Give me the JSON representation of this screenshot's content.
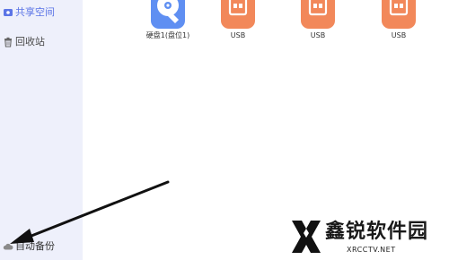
{
  "sidebar": {
    "items": [
      {
        "label": "共享空间",
        "icon": "share-space-icon",
        "active": true
      },
      {
        "label": "回收站",
        "icon": "recycle-bin-icon",
        "active": false
      },
      {
        "label": "自动备份",
        "icon": "cloud-backup-icon",
        "active": false
      }
    ]
  },
  "devices": [
    {
      "name": "硬盘1(盘位1)",
      "icon": "hard-disk-icon",
      "color": "#5f8ff2"
    },
    {
      "name": "USB",
      "icon": "usb-drive-icon",
      "color": "#f2885a"
    },
    {
      "name": "USB",
      "icon": "usb-drive-icon",
      "color": "#f2885a"
    },
    {
      "name": "USB",
      "icon": "usb-drive-icon",
      "color": "#f2885a"
    }
  ],
  "watermark": {
    "brand": "鑫锐软件园",
    "domain": "XRCCTV.NET"
  },
  "colors": {
    "sidebar_bg": "#eef0fb",
    "accent": "#5b74e6",
    "disk_tile": "#5f8ff2",
    "usb_tile": "#f2885a",
    "arrow": "#111111"
  }
}
